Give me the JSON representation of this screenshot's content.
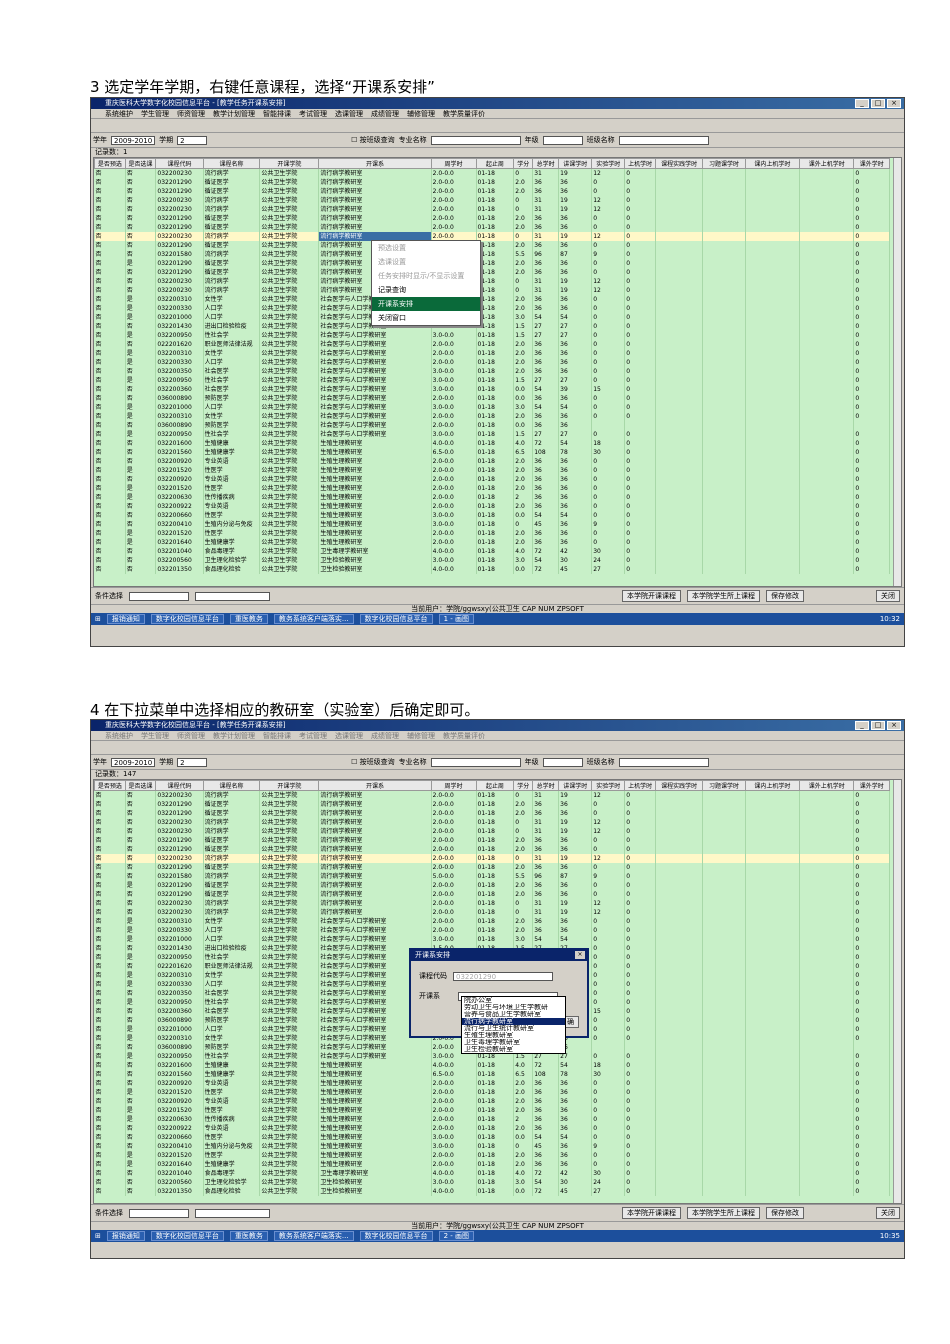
{
  "caption1": "3 选定学年学期，右键任意课程，选择“开课系安排”",
  "caption2": "4 在下拉菜单中选择相应的教研室（实验室）后确定即可。",
  "app": {
    "title": "重庆医科大学数字化校园信息平台 - [教学任务开课系安排]",
    "menus": [
      "系统维护",
      "学生管理",
      "师资管理",
      "教学计划管理",
      "智能排课",
      "考试管理",
      "选课管理",
      "成绩管理",
      "辅修管理",
      "教学质量评价"
    ],
    "year_label": "学年",
    "year_value": "2009-2010",
    "term_label": "学期",
    "term_value": "2",
    "class_query": "按班级查询",
    "major_label": "专业名称",
    "grade_label": "年级",
    "classname_label": "班级名称",
    "count1": "记录数：1",
    "count2": "记录数：147",
    "columns": [
      "是否预选",
      "是否选课",
      "课程代码",
      "课程名称",
      "开课学院",
      "开课系",
      "周学时",
      "起止周",
      "学分",
      "总学时",
      "讲课学时",
      "实验学时",
      "上机学时",
      "课程实践学时",
      "习题课学时",
      "课内上机学时",
      "课外上机学时",
      "课外学时"
    ],
    "rows": [
      [
        "否",
        "否",
        "032200230",
        "流行病学",
        "公共卫生学院",
        "流行病学教研室",
        "2.0-0.0",
        "01-18",
        "0",
        "31",
        "19",
        "12",
        "0",
        "",
        "",
        "",
        "",
        "0"
      ],
      [
        "否",
        "否",
        "032201290",
        "循证医学",
        "公共卫生学院",
        "流行病学教研室",
        "2.0-0.0",
        "01-18",
        "2.0",
        "36",
        "36",
        "0",
        "0",
        "",
        "",
        "",
        "",
        "0"
      ],
      [
        "否",
        "否",
        "032201290",
        "循证医学",
        "公共卫生学院",
        "流行病学教研室",
        "2.0-0.0",
        "01-18",
        "2.0",
        "36",
        "36",
        "0",
        "0",
        "",
        "",
        "",
        "",
        "0"
      ],
      [
        "否",
        "否",
        "032200230",
        "流行病学",
        "公共卫生学院",
        "流行病学教研室",
        "2.0-0.0",
        "01-18",
        "0",
        "31",
        "19",
        "12",
        "0",
        "",
        "",
        "",
        "",
        "0"
      ],
      [
        "否",
        "否",
        "032200230",
        "流行病学",
        "公共卫生学院",
        "流行病学教研室",
        "2.0-0.0",
        "01-18",
        "0",
        "31",
        "19",
        "12",
        "0",
        "",
        "",
        "",
        "",
        "0"
      ],
      [
        "否",
        "否",
        "032201290",
        "循证医学",
        "公共卫生学院",
        "流行病学教研室",
        "2.0-0.0",
        "01-18",
        "2.0",
        "36",
        "36",
        "0",
        "0",
        "",
        "",
        "",
        "",
        "0"
      ],
      [
        "否",
        "否",
        "032201290",
        "循证医学",
        "公共卫生学院",
        "流行病学教研室",
        "2.0-0.0",
        "01-18",
        "2.0",
        "36",
        "36",
        "0",
        "0",
        "",
        "",
        "",
        "",
        "0"
      ],
      [
        "否",
        "否",
        "032200230",
        "流行病学",
        "公共卫生学院",
        "流行病学教研室",
        "2.0-0.0",
        "01-18",
        "0",
        "31",
        "19",
        "12",
        "0",
        "",
        "",
        "",
        "",
        "0"
      ],
      [
        "否",
        "否",
        "032201290",
        "循证医学",
        "公共卫生学院",
        "流行病学教研室",
        "2.0-0.0",
        "01-18",
        "2.0",
        "36",
        "36",
        "0",
        "0",
        "",
        "",
        "",
        "",
        "0"
      ],
      [
        "否",
        "否",
        "032201580",
        "流行病学",
        "公共卫生学院",
        "流行病学教研室",
        "5.0-0.0",
        "01-18",
        "5.5",
        "96",
        "87",
        "9",
        "0",
        "",
        "",
        "",
        "",
        "0"
      ],
      [
        "否",
        "是",
        "032201290",
        "循证医学",
        "公共卫生学院",
        "流行病学教研室",
        "2.0-0.0",
        "01-18",
        "2.0",
        "36",
        "36",
        "0",
        "0",
        "",
        "",
        "",
        "",
        "0"
      ],
      [
        "否",
        "否",
        "032201290",
        "循证医学",
        "公共卫生学院",
        "流行病学教研室",
        "2.0-0.0",
        "01-18",
        "2.0",
        "36",
        "36",
        "0",
        "0",
        "",
        "",
        "",
        "",
        "0"
      ],
      [
        "否",
        "否",
        "032200230",
        "流行病学",
        "公共卫生学院",
        "流行病学教研室",
        "2.0-0.0",
        "01-18",
        "0",
        "31",
        "19",
        "12",
        "0",
        "",
        "",
        "",
        "",
        "0"
      ],
      [
        "否",
        "否",
        "032200230",
        "流行病学",
        "公共卫生学院",
        "流行病学教研室",
        "2.0-0.0",
        "01-18",
        "0",
        "31",
        "19",
        "12",
        "0",
        "",
        "",
        "",
        "",
        "0"
      ],
      [
        "否",
        "是",
        "032200310",
        "女性学",
        "公共卫生学院",
        "社会医学与人口学教研室",
        "2.0-0.0",
        "01-18",
        "2.0",
        "36",
        "36",
        "0",
        "0",
        "",
        "",
        "",
        "",
        "0"
      ],
      [
        "否",
        "是",
        "032200330",
        "人口学",
        "公共卫生学院",
        "社会医学与人口学教研室",
        "2.0-0.0",
        "01-18",
        "2.0",
        "36",
        "36",
        "0",
        "0",
        "",
        "",
        "",
        "",
        "0"
      ],
      [
        "否",
        "是",
        "032201000",
        "人口学",
        "公共卫生学院",
        "社会医学与人口学教研室",
        "3.0-0.0",
        "01-18",
        "3.0",
        "54",
        "54",
        "0",
        "0",
        "",
        "",
        "",
        "",
        "0"
      ],
      [
        "否",
        "否",
        "032201430",
        "进出口检验检疫",
        "公共卫生学院",
        "社会医学与人口学教研室",
        "1.5-0.0",
        "01-18",
        "1.5",
        "27",
        "27",
        "0",
        "0",
        "",
        "",
        "",
        "",
        "0"
      ],
      [
        "否",
        "是",
        "032200950",
        "性社会学",
        "公共卫生学院",
        "社会医学与人口学教研室",
        "3.0-0.0",
        "01-18",
        "1.5",
        "27",
        "27",
        "0",
        "0",
        "",
        "",
        "",
        "",
        "0"
      ],
      [
        "否",
        "否",
        "022201620",
        "职业医师法律法规",
        "公共卫生学院",
        "社会医学与人口学教研室",
        "2.0-0.0",
        "01-18",
        "2.0",
        "36",
        "36",
        "0",
        "0",
        "",
        "",
        "",
        "",
        "0"
      ],
      [
        "否",
        "是",
        "032200310",
        "女性学",
        "公共卫生学院",
        "社会医学与人口学教研室",
        "2.0-0.0",
        "01-18",
        "2.0",
        "36",
        "36",
        "0",
        "0",
        "",
        "",
        "",
        "",
        "0"
      ],
      [
        "否",
        "是",
        "032200330",
        "人口学",
        "公共卫生学院",
        "社会医学与人口学教研室",
        "2.0-0.0",
        "01-18",
        "2.0",
        "36",
        "36",
        "0",
        "0",
        "",
        "",
        "",
        "",
        "0"
      ],
      [
        "否",
        "否",
        "032200350",
        "社会医学",
        "公共卫生学院",
        "社会医学与人口学教研室",
        "3.0-0.0",
        "01-18",
        "2.0",
        "36",
        "36",
        "0",
        "0",
        "",
        "",
        "",
        "",
        "0"
      ],
      [
        "否",
        "是",
        "032200950",
        "性社会学",
        "公共卫生学院",
        "社会医学与人口学教研室",
        "3.0-0.0",
        "01-18",
        "1.5",
        "27",
        "27",
        "0",
        "0",
        "",
        "",
        "",
        "",
        "0"
      ],
      [
        "否",
        "否",
        "032200360",
        "社会医学",
        "公共卫生学院",
        "社会医学与人口学教研室",
        "3.0-0.0",
        "01-18",
        "0.0",
        "54",
        "39",
        "15",
        "0",
        "",
        "",
        "",
        "",
        "0"
      ],
      [
        "否",
        "否",
        "036000890",
        "预防医学",
        "公共卫生学院",
        "社会医学与人口学教研室",
        "2.0-0.0",
        "01-18",
        "0.0",
        "36",
        "36",
        "0",
        "0",
        "",
        "",
        "",
        "",
        "0"
      ],
      [
        "否",
        "是",
        "032201000",
        "人口学",
        "公共卫生学院",
        "社会医学与人口学教研室",
        "3.0-0.0",
        "01-18",
        "3.0",
        "54",
        "54",
        "0",
        "0",
        "",
        "",
        "",
        "",
        "0"
      ],
      [
        "否",
        "是",
        "032200310",
        "女性学",
        "公共卫生学院",
        "社会医学与人口学教研室",
        "2.0-0.0",
        "01-18",
        "2.0",
        "36",
        "36",
        "0",
        "0",
        "",
        "",
        "",
        "",
        "0"
      ],
      [
        "否",
        "否",
        "036000890",
        "预防医学",
        "公共卫生学院",
        "社会医学与人口学教研室",
        "2.0-0.0",
        "01-18",
        "0.0",
        "36",
        "36",
        "",
        "",
        "",
        "",
        "",
        "",
        ""
      ],
      [
        "否",
        "是",
        "032200950",
        "性社会学",
        "公共卫生学院",
        "社会医学与人口学教研室",
        "3.0-0.0",
        "01-18",
        "1.5",
        "27",
        "27",
        "0",
        "0",
        "",
        "",
        "",
        "",
        "0"
      ],
      [
        "否",
        "否",
        "032201600",
        "生殖健康",
        "公共卫生学院",
        "生殖生理教研室",
        "4.0-0.0",
        "01-18",
        "4.0",
        "72",
        "54",
        "18",
        "0",
        "",
        "",
        "",
        "",
        "0"
      ],
      [
        "否",
        "否",
        "032201560",
        "生殖健康学",
        "公共卫生学院",
        "生殖生理教研室",
        "6.5-0.0",
        "01-18",
        "6.5",
        "108",
        "78",
        "30",
        "0",
        "",
        "",
        "",
        "",
        "0"
      ],
      [
        "否",
        "否",
        "032200920",
        "专业英语",
        "公共卫生学院",
        "生殖生理教研室",
        "2.0-0.0",
        "01-18",
        "2.0",
        "36",
        "36",
        "0",
        "0",
        "",
        "",
        "",
        "",
        "0"
      ],
      [
        "否",
        "是",
        "032201520",
        "性医学",
        "公共卫生学院",
        "生殖生理教研室",
        "2.0-0.0",
        "01-18",
        "2.0",
        "36",
        "36",
        "0",
        "0",
        "",
        "",
        "",
        "",
        "0"
      ],
      [
        "否",
        "否",
        "032200920",
        "专业英语",
        "公共卫生学院",
        "生殖生理教研室",
        "2.0-0.0",
        "01-18",
        "2.0",
        "36",
        "36",
        "0",
        "0",
        "",
        "",
        "",
        "",
        "0"
      ],
      [
        "否",
        "是",
        "032201520",
        "性医学",
        "公共卫生学院",
        "生殖生理教研室",
        "2.0-0.0",
        "01-18",
        "2.0",
        "36",
        "36",
        "0",
        "0",
        "",
        "",
        "",
        "",
        "0"
      ],
      [
        "否",
        "是",
        "032200630",
        "性传播疾病",
        "公共卫生学院",
        "生殖生理教研室",
        "2.0-0.0",
        "01-18",
        "2",
        "36",
        "36",
        "0",
        "0",
        "",
        "",
        "",
        "",
        "0"
      ],
      [
        "否",
        "否",
        "032200922",
        "专业英语",
        "公共卫生学院",
        "生殖生理教研室",
        "2.0-0.0",
        "01-18",
        "2.0",
        "36",
        "36",
        "0",
        "0",
        "",
        "",
        "",
        "",
        "0"
      ],
      [
        "否",
        "否",
        "032200660",
        "性医学",
        "公共卫生学院",
        "生殖生理教研室",
        "3.0-0.0",
        "01-18",
        "0.0",
        "54",
        "54",
        "0",
        "0",
        "",
        "",
        "",
        "",
        "0"
      ],
      [
        "否",
        "否",
        "032200410",
        "生殖内分泌与免疫",
        "公共卫生学院",
        "生殖生理教研室",
        "3.0-0.0",
        "01-18",
        "0",
        "45",
        "36",
        "9",
        "0",
        "",
        "",
        "",
        "",
        "0"
      ],
      [
        "否",
        "是",
        "032201520",
        "性医学",
        "公共卫生学院",
        "生殖生理教研室",
        "2.0-0.0",
        "01-18",
        "2.0",
        "36",
        "36",
        "0",
        "0",
        "",
        "",
        "",
        "",
        "0"
      ],
      [
        "否",
        "是",
        "032201640",
        "生殖健康学",
        "公共卫生学院",
        "生殖生理教研室",
        "2.0-0.0",
        "01-18",
        "2.0",
        "36",
        "36",
        "0",
        "0",
        "",
        "",
        "",
        "",
        "0"
      ],
      [
        "否",
        "否",
        "032201040",
        "食品毒理学",
        "公共卫生学院",
        "卫生毒理学教研室",
        "4.0-0.0",
        "01-18",
        "4.0",
        "72",
        "42",
        "30",
        "0",
        "",
        "",
        "",
        "",
        "0"
      ],
      [
        "否",
        "否",
        "032200560",
        "卫生理化检验学",
        "公共卫生学院",
        "卫生检验教研室",
        "3.0-0.0",
        "01-18",
        "3.0",
        "54",
        "30",
        "24",
        "0",
        "",
        "",
        "",
        "",
        "0"
      ],
      [
        "否",
        "否",
        "032201350",
        "食品理化检验",
        "公共卫生学院",
        "卫生检验教研室",
        "4.0-0.0",
        "01-18",
        "0.0",
        "72",
        "45",
        "27",
        "0",
        "",
        "",
        "",
        "",
        "0"
      ]
    ],
    "context_menu": [
      "预选设置",
      "选课设置",
      "任务安排时显示/不显示设置",
      "记录查询",
      "开课系安排",
      "关闭窗口"
    ],
    "cond_label": "条件选择",
    "btn_college_arrange": "本学院开课课程",
    "btn_student_course": "本学院学生所上课程",
    "btn_save": "保存修改",
    "btn_close": "关闭",
    "status": "当前用户：学院/ggwsxy(公共卫生 CAP   NUM   ZPSOFT",
    "taskbar1": [
      "报销通知",
      "数字化校园信息平台",
      "重医教务",
      "教务系统客户端落实...",
      "数字化校园信息平台",
      "1 - 画图",
      "10:32"
    ],
    "taskbar2": [
      "报销通知",
      "数字化校园信息平台",
      "重医教务",
      "教务系统客户端落实...",
      "数字化校园信息平台",
      "2 - 画图",
      "10:35"
    ],
    "dialog": {
      "title": "开课系安排",
      "course_code_label": "课程代码",
      "course_code_value": "032201290",
      "dept_label": "开课系",
      "confirm": "确",
      "options": [
        "院办公室",
        "劳动卫生与环境卫生学教研",
        "营养与食品卫生学教研室",
        "流行病学教研室",
        "流行与卫生统计教研室",
        "生殖生理教研室",
        "卫生毒理学教研室",
        "卫生检验教研室"
      ]
    }
  }
}
